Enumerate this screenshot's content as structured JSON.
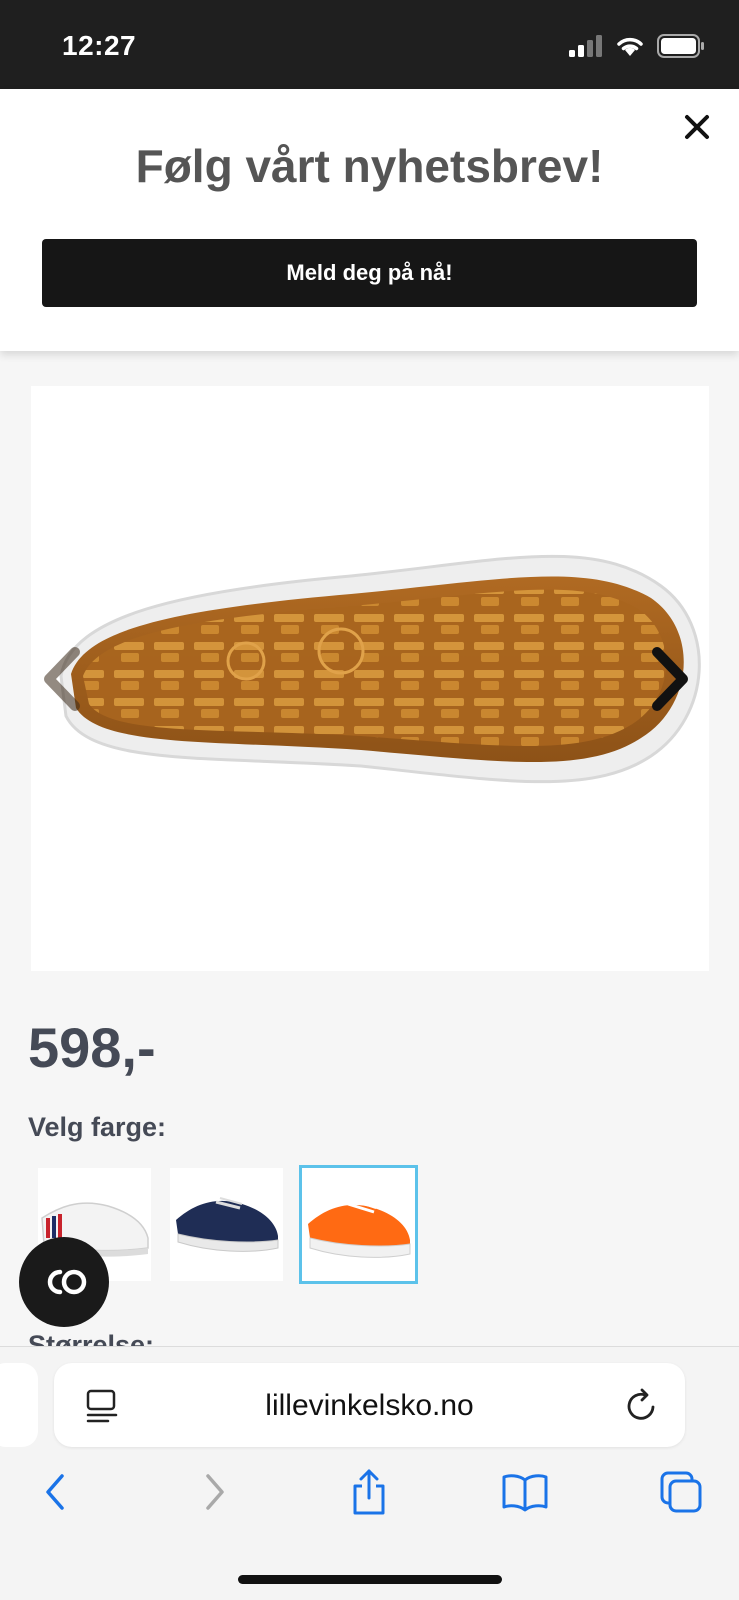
{
  "status_bar": {
    "time": "12:27"
  },
  "banner": {
    "title": "Følg vårt nyhetsbrev!",
    "button_label": "Meld deg på nå!"
  },
  "product": {
    "price": "598,-",
    "color_label": "Velg farge:",
    "size_label": "Størrelse:",
    "colors": [
      {
        "icon": "white-sneaker-swatch",
        "hex": "#ffffff",
        "selected": false
      },
      {
        "icon": "navy-sneaker-swatch",
        "hex": "#1f2d55",
        "selected": false
      },
      {
        "icon": "orange-sneaker-swatch",
        "hex": "#ff6a13",
        "selected": true
      }
    ],
    "image_icon": "shoe-sole-image"
  },
  "browser": {
    "url": "lillevinkelsko.no"
  },
  "colors": {
    "accent_selected": "#5cc2ea",
    "safari_blue": "#1a73e8"
  }
}
